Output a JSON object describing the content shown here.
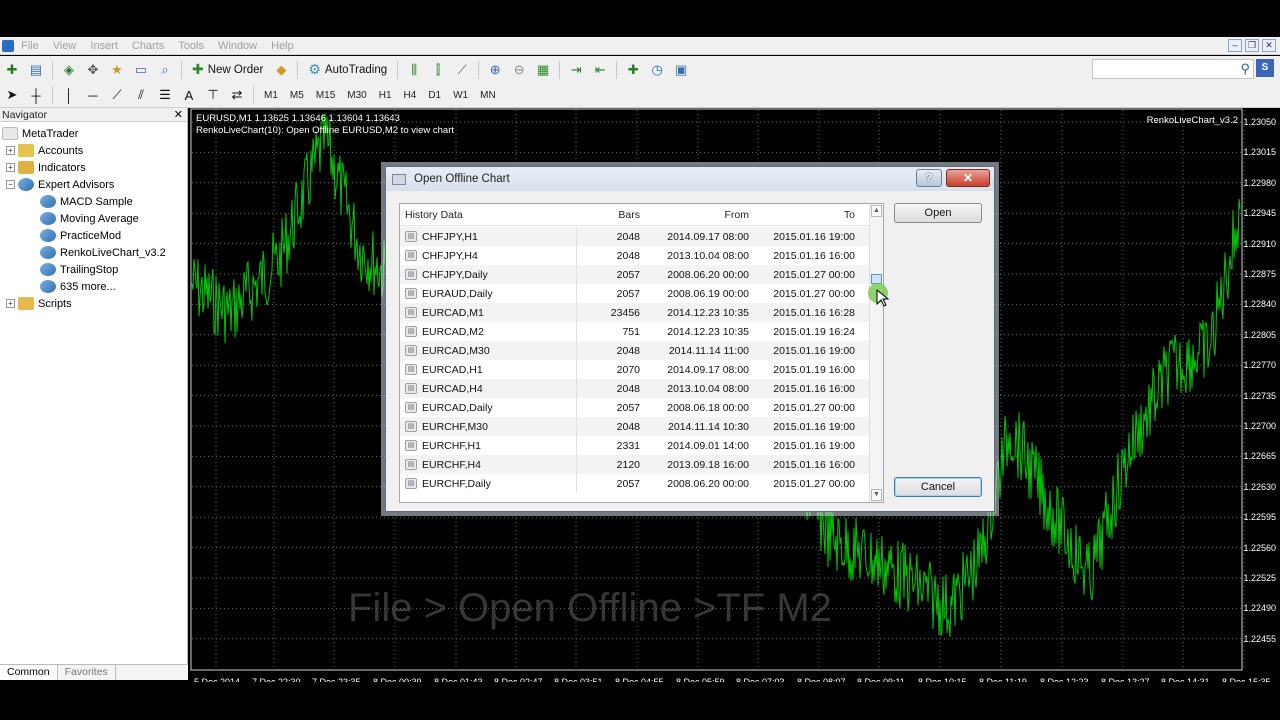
{
  "menu": {
    "items": [
      "File",
      "View",
      "Insert",
      "Charts",
      "Tools",
      "Window",
      "Help"
    ]
  },
  "toolbar": {
    "new_order": "New Order",
    "autotrading": "AutoTrading",
    "timeframes": [
      "M1",
      "M5",
      "M15",
      "M30",
      "H1",
      "H4",
      "D1",
      "W1",
      "MN"
    ]
  },
  "navigator": {
    "title": "Navigator",
    "root": "MetaTrader",
    "accounts": "Accounts",
    "indicators": "Indicators",
    "expert_advisors": "Expert Advisors",
    "experts": [
      "MACD Sample",
      "Moving Average",
      "PracticeMod",
      "RenkoLiveChart_v3.2",
      "TrailingStop",
      "635 more..."
    ],
    "scripts": "Scripts",
    "tabs": [
      "Common",
      "Favorites"
    ]
  },
  "chart": {
    "title": "EURUSD,M1  1.13625 1.13646 1.13604 1.13643",
    "subtitle": "RenkoLiveChart(10): Open Offline EURUSD,M2 to view chart",
    "ea_label": "RenkoLiveChart_v3.2",
    "price_labels": [
      "1.23050",
      "1.23015",
      "1.22980",
      "1.22945",
      "1.22910",
      "1.22875",
      "1.22840",
      "1.22805",
      "1.22770",
      "1.22735",
      "1.22700",
      "1.22665",
      "1.22630",
      "1.22595",
      "1.22560",
      "1.22525",
      "1.22490",
      "1.22455"
    ],
    "time_labels": [
      "5 Dec 2014",
      "7 Dec 22:30",
      "7 Dec 23:35",
      "8 Dec 00:39",
      "8 Dec 01:43",
      "8 Dec 02:47",
      "8 Dec 03:51",
      "8 Dec 04:55",
      "8 Dec 05:59",
      "8 Dec 07:03",
      "8 Dec 08:07",
      "8 Dec 09:11",
      "8 Dec 10:15",
      "8 Dec 11:19",
      "8 Dec 12:23",
      "8 Dec 13:27",
      "8 Dec 14:31",
      "8 Dec 15:35"
    ],
    "watermark": "File > Open Offline >TF M2",
    "line_color": "#00c800"
  },
  "dialog": {
    "title": "Open Offline Chart",
    "help": "?",
    "close": "✕",
    "columns": {
      "name": "History Data",
      "bars": "Bars",
      "from": "From",
      "to": "To"
    },
    "rows": [
      {
        "name": "CHFJPY,H1",
        "bars": "2048",
        "from": "2014.09.17 08:00",
        "to": "2015.01.16 19:00"
      },
      {
        "name": "CHFJPY,H4",
        "bars": "2048",
        "from": "2013.10.04 08:00",
        "to": "2015.01.16 16:00"
      },
      {
        "name": "CHFJPY,Daily",
        "bars": "2057",
        "from": "2008.06.20 00:00",
        "to": "2015.01.27 00:00"
      },
      {
        "name": "EURAUD,Daily",
        "bars": "2057",
        "from": "2008.06.19 00:00",
        "to": "2015.01.27 00:00"
      },
      {
        "name": "EURCAD,M1",
        "bars": "23456",
        "from": "2014.12.23 10:35",
        "to": "2015.01.16 16:28"
      },
      {
        "name": "EURCAD,M2",
        "bars": "751",
        "from": "2014.12.23 10:35",
        "to": "2015.01.19 16:24"
      },
      {
        "name": "EURCAD,M30",
        "bars": "2048",
        "from": "2014.11.14 11:00",
        "to": "2015.01.16 19:00"
      },
      {
        "name": "EURCAD,H1",
        "bars": "2070",
        "from": "2014.09.17 08:00",
        "to": "2015.01.19 16:00"
      },
      {
        "name": "EURCAD,H4",
        "bars": "2048",
        "from": "2013.10.04 08:00",
        "to": "2015.01.16 16:00"
      },
      {
        "name": "EURCAD,Daily",
        "bars": "2057",
        "from": "2008.06.18 00:00",
        "to": "2015.01.27 00:00"
      },
      {
        "name": "EURCHF,M30",
        "bars": "2048",
        "from": "2014.11.14 10:30",
        "to": "2015.01.16 19:00"
      },
      {
        "name": "EURCHF,H1",
        "bars": "2331",
        "from": "2014.09.01 14:00",
        "to": "2015.01.16 19:00"
      },
      {
        "name": "EURCHF,H4",
        "bars": "2120",
        "from": "2013.09.18 16:00",
        "to": "2015.01.16 16:00"
      },
      {
        "name": "EURCHF,Daily",
        "bars": "2057",
        "from": "2008.06.20 00:00",
        "to": "2015.01.27 00:00"
      }
    ],
    "open_label": "Open",
    "cancel_label": "Cancel"
  }
}
